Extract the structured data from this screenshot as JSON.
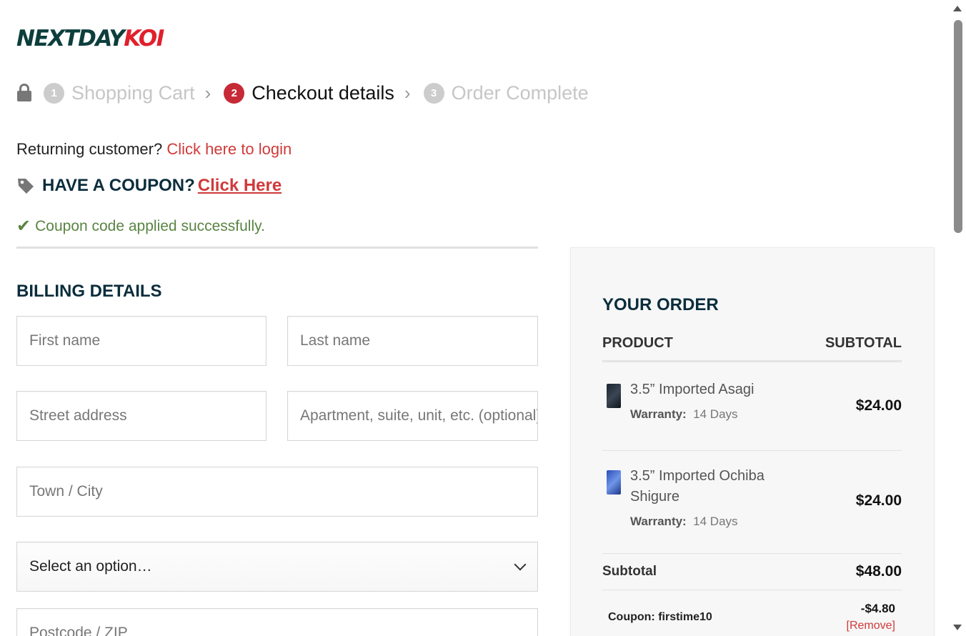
{
  "logo": {
    "part1": "NEXTDAY",
    "part2": "KOI",
    "colors": {
      "part1": "#0c3e3c",
      "part2": "#e0202d"
    }
  },
  "steps": [
    {
      "number": "1",
      "label": "Shopping Cart",
      "state": "done"
    },
    {
      "number": "2",
      "label": "Checkout details",
      "state": "active"
    },
    {
      "number": "3",
      "label": "Order Complete",
      "state": "pending"
    }
  ],
  "returning": {
    "text": "Returning customer?",
    "link": "Click here to login"
  },
  "coupon": {
    "heading": "HAVE A COUPON?",
    "link": "Click Here",
    "success": "Coupon code applied successfully."
  },
  "billing": {
    "title": "BILLING DETAILS",
    "first_name_placeholder": "First name",
    "last_name_placeholder": "Last name",
    "street_placeholder": "Street address",
    "apartment_placeholder": "Apartment, suite, unit, etc. (optional)",
    "city_placeholder": "Town / City",
    "country_select": "Select an option…",
    "postcode_placeholder": "Postcode / ZIP"
  },
  "order": {
    "title": "YOUR ORDER",
    "col_product": "PRODUCT",
    "col_subtotal": "SUBTOTAL",
    "items": [
      {
        "name": "3.5” Imported Asagi",
        "warranty_label": "Warranty:",
        "warranty_value": "14 Days",
        "price": "$24.00"
      },
      {
        "name": "3.5” Imported Ochiba Shigure",
        "warranty_label": "Warranty:",
        "warranty_value": "14 Days",
        "price": "$24.00"
      }
    ],
    "subtotal_label": "Subtotal",
    "subtotal_value": "$48.00",
    "coupon_label": "Coupon: firstime10",
    "coupon_amount": "-$4.80",
    "coupon_remove": "[Remove]"
  },
  "colors": {
    "accent_red": "#d03a3a",
    "step_active": "#c62a36",
    "heading_navy": "#0b2d3c",
    "success_green": "#5a8442"
  }
}
